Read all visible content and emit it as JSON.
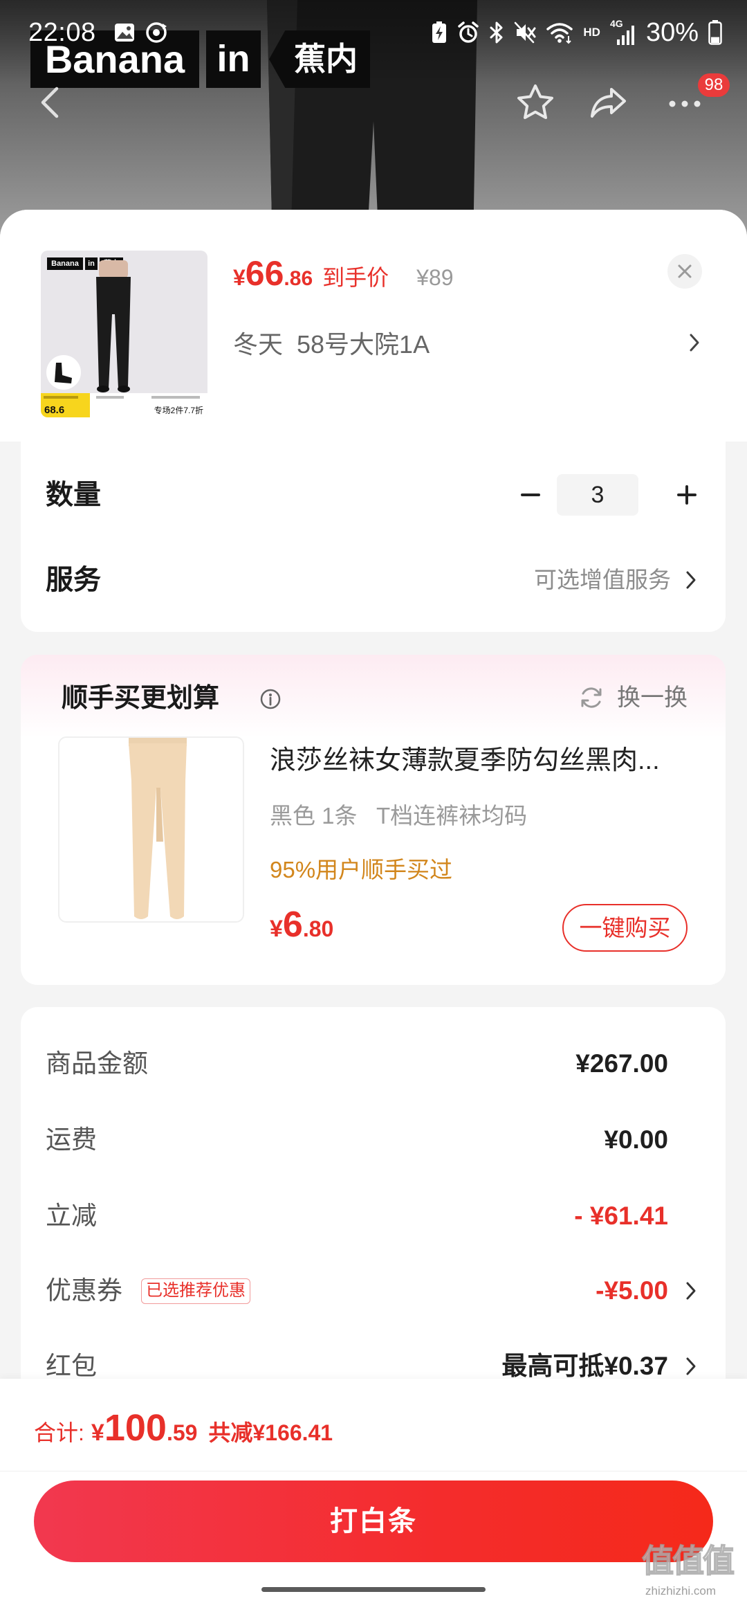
{
  "status_bar": {
    "time": "22:08",
    "hd": "HD",
    "network": "4G",
    "battery": "30%",
    "battery_level": 0.3,
    "icons": [
      "gallery-icon",
      "sync-icon",
      "battery-saver-icon",
      "alarm-icon",
      "bluetooth-icon",
      "mute-icon",
      "wifi-icon",
      "signal-icon",
      "battery-icon"
    ]
  },
  "hero": {
    "brand": [
      "Banana",
      "in",
      "蕉内"
    ],
    "more_badge": "98",
    "icons": [
      "back-arrow-icon",
      "star-icon",
      "share-icon",
      "more-icon"
    ]
  },
  "product": {
    "thumb": {
      "brand": [
        "Banana",
        "in",
        "蕉内"
      ],
      "price": "68.6",
      "promo": "专场2件7.7折"
    },
    "price": {
      "currency": "¥",
      "integer": "66",
      "decimal": ".86",
      "label": "到手价"
    },
    "original_price": "¥89",
    "variant": "冬天  58号大院1A"
  },
  "quantity": {
    "label": "数量",
    "value": "3"
  },
  "service": {
    "label": "服务",
    "value": "可选增值服务"
  },
  "bundle": {
    "title": "顺手买更划算",
    "refresh": "换一换",
    "item": {
      "title": "浪莎丝袜女薄款夏季防勾丝黑肉...",
      "spec": "黑色 1条   T档连裤袜均码",
      "social_proof": "95%用户顺手买过",
      "price": {
        "currency": "¥",
        "integer": "6",
        "decimal": ".80"
      },
      "buy_label": "一键购买"
    }
  },
  "summary": {
    "rows": [
      {
        "label": "商品金额",
        "value": "¥267.00"
      },
      {
        "label": "运费",
        "value": "¥0.00"
      },
      {
        "label": "立减",
        "value": "- ¥61.41"
      },
      {
        "label": "优惠券",
        "badge": "已选推荐优惠",
        "value": "-¥5.00"
      },
      {
        "label": "红包",
        "value": "最高可抵¥0.37"
      }
    ]
  },
  "footer": {
    "total_label": "合计:",
    "total": {
      "currency": "¥",
      "integer": "100",
      "decimal": ".59"
    },
    "saved": "共减¥166.41",
    "pay_button": "打白条"
  },
  "watermark": {
    "logo": "值值值",
    "url": "zhizhizhi.com"
  },
  "colors": {
    "accent_red": "#e8302a",
    "gold": "#d2861c",
    "page_bg": "#f4f4f4",
    "text": "#1f1f1f",
    "muted": "#8c8c8c"
  }
}
